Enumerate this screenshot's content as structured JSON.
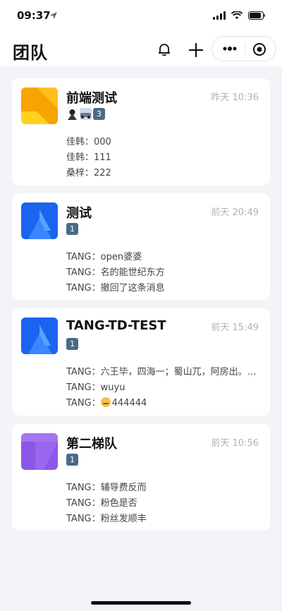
{
  "status": {
    "time": "09:37"
  },
  "header": {
    "title": "团队"
  },
  "teams": [
    {
      "name": "前端测试",
      "time": "昨天 10:36",
      "avatar_color": "#f6a400",
      "members": [
        "member-1",
        "member-2",
        "member-3"
      ],
      "member_badge": "3",
      "messages": [
        {
          "text": "佳韩：000"
        },
        {
          "text": "佳韩：111"
        },
        {
          "text": "桑梓：222"
        }
      ]
    },
    {
      "name": "测试",
      "time": "前天 20:49",
      "avatar_color": "#1a64f0",
      "members": [
        "member-1"
      ],
      "member_badge": "1",
      "messages": [
        {
          "text": "TANG：open婆婆"
        },
        {
          "text": "TANG：名的能世纪东方"
        },
        {
          "text": "TANG：撤回了这条消息"
        }
      ]
    },
    {
      "name": "TANG-TD-TEST",
      "time": "前天 15:49",
      "avatar_color": "#1a64f0",
      "members": [
        "member-1"
      ],
      "member_badge": "1",
      "messages": [
        {
          "text": "TANG：六王毕，四海一；蜀山兀，阿房出。覆压三百余里"
        },
        {
          "text": "TANG：wuyu"
        },
        {
          "text": "TANG：",
          "emoji": true,
          "after": "444444"
        }
      ]
    },
    {
      "name": "第二梯队",
      "time": "前天 10:56",
      "avatar_color": "#8c56e6",
      "members": [
        "member-1"
      ],
      "member_badge": "1",
      "messages": [
        {
          "text": "TANG：辅导费反而"
        },
        {
          "text": "TANG：粉色是否"
        },
        {
          "text": "TANG：粉丝发顺丰"
        }
      ]
    }
  ]
}
